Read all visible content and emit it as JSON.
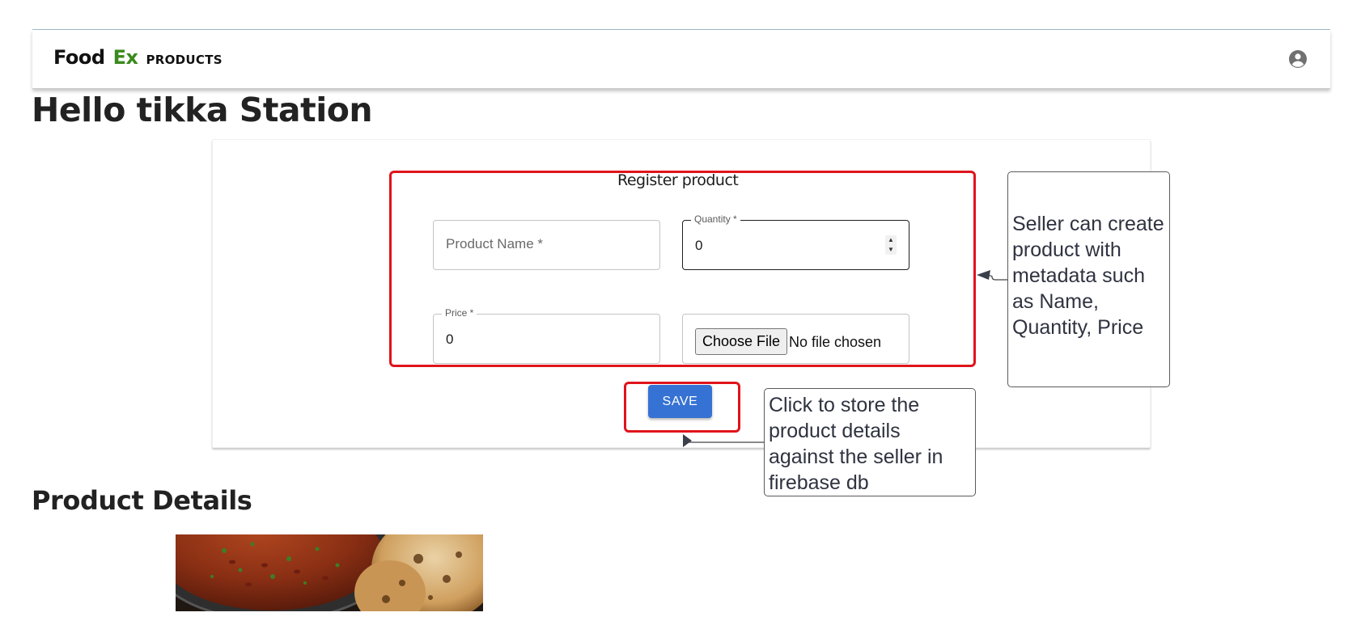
{
  "appbar": {
    "brand_food": "Food",
    "brand_ex": "Ex",
    "products_link": "PRODUCTS",
    "account_icon": "account-circle-icon"
  },
  "greeting": "Hello tikka Station",
  "form": {
    "title": "Register product",
    "product_name_label": "Product Name *",
    "quantity_label": "Quantity *",
    "quantity_value": "0",
    "price_label": "Price *",
    "price_value": "0",
    "choose_file_label": "Choose File",
    "no_file_text": "No file chosen",
    "save_label": "SAVE"
  },
  "annotations": {
    "seller_note": "Seller can create product with metadata such as Name, Quantity, Price",
    "save_note": "Click to store the product details against the seller in firebase db"
  },
  "product_details": {
    "title": "Product Details",
    "image_icon": "food-dish-image"
  },
  "colors": {
    "brand_green": "#3a8a1e",
    "save_blue": "#3672d4",
    "highlight_red": "#e0141b"
  }
}
